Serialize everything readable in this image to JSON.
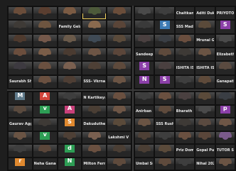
{
  "colors": {
    "accent": "#f4d35e",
    "tile_bg": "#262626",
    "letter_tiles": [
      "#3d7bb5",
      "#d4453b",
      "#2e9e55",
      "#e0892f",
      "#8b3fa8",
      "#c9407a",
      "#5f7a8a",
      "#7a5a3f"
    ]
  },
  "panels": [
    {
      "id": "top-left",
      "cols": 5,
      "rows": 6,
      "tiles": [
        {
          "name": "",
          "kind": "video",
          "c": "#6a4d3a"
        },
        {
          "name": "",
          "kind": "video",
          "c": "#5a3e30"
        },
        {
          "name": "",
          "kind": "video",
          "c": "#7b5b43"
        },
        {
          "name": "",
          "kind": "video",
          "c": "#4d5a3a",
          "active": true
        },
        {
          "name": "",
          "kind": "video",
          "c": "#6a4d3a"
        },
        {
          "name": "",
          "kind": "video",
          "c": "#3e3a36"
        },
        {
          "name": "",
          "kind": "video",
          "c": "#6e5540"
        },
        {
          "name": "Family Gelaz",
          "kind": "name"
        },
        {
          "name": "",
          "kind": "video",
          "c": "#8a6a4e"
        },
        {
          "name": "",
          "kind": "video",
          "c": "#5a4538"
        },
        {
          "name": "",
          "kind": "video",
          "c": "#4e3a2e"
        },
        {
          "name": "",
          "kind": "video",
          "c": "#74584a"
        },
        {
          "name": "",
          "kind": "video",
          "c": "#6a5a4a"
        },
        {
          "name": "",
          "kind": "video",
          "c": "#3f4a55"
        },
        {
          "name": "",
          "kind": "video",
          "c": "#5a4a3a"
        },
        {
          "name": "",
          "kind": "video",
          "c": "#6b4e3d"
        },
        {
          "name": "",
          "kind": "video",
          "c": "#7a5d48"
        },
        {
          "name": "",
          "kind": "video",
          "c": "#4a3b31"
        },
        {
          "name": "",
          "kind": "video",
          "c": "#6d5545"
        },
        {
          "name": "",
          "kind": "video",
          "c": "#5b463a"
        },
        {
          "name": "",
          "kind": "video",
          "c": "#3d3a40"
        },
        {
          "name": "",
          "kind": "video",
          "c": "#6a5040"
        },
        {
          "name": "",
          "kind": "video",
          "c": "#7a6050"
        },
        {
          "name": "",
          "kind": "video",
          "c": "#4e4036"
        },
        {
          "name": "",
          "kind": "video",
          "c": "#5e4a3c"
        },
        {
          "name": "Saurabh Shahane",
          "kind": "name"
        },
        {
          "name": "",
          "kind": "video",
          "c": "#6a5040"
        },
        {
          "name": "",
          "kind": "video",
          "c": "#4e3e34"
        },
        {
          "name": "SSS- Vkrnа 2020...",
          "kind": "name"
        },
        {
          "name": "",
          "kind": "video",
          "c": "#6b5444"
        }
      ]
    },
    {
      "id": "top-right",
      "cols": 5,
      "rows": 6,
      "tiles": [
        {
          "name": "",
          "kind": "video",
          "c": "#4a4a4a"
        },
        {
          "name": "",
          "kind": "video",
          "c": "#3e3e3e"
        },
        {
          "name": "Chaitkanya deni...",
          "kind": "name"
        },
        {
          "name": "Aditi Dukhale ...",
          "kind": "name"
        },
        {
          "name": "PRIYOTOSH D...",
          "kind": "name"
        },
        {
          "name": "",
          "kind": "video",
          "c": "#3a3a3a"
        },
        {
          "name": "",
          "kind": "letter",
          "l": "S",
          "li": 0
        },
        {
          "name": "SSS Madhuri Kh...",
          "kind": "name"
        },
        {
          "name": "",
          "kind": "video",
          "c": "#5a4a3a"
        },
        {
          "name": "",
          "kind": "letter",
          "l": "S",
          "li": 4
        },
        {
          "name": "",
          "kind": "video",
          "c": "#4a4040"
        },
        {
          "name": "",
          "kind": "video",
          "c": "#3a3e44"
        },
        {
          "name": "",
          "kind": "video",
          "c": "#6a4e3e"
        },
        {
          "name": "Mrunal Gandhi",
          "kind": "name"
        },
        {
          "name": "",
          "kind": "video",
          "c": "#4a4a4a"
        },
        {
          "name": "Sandeep Dua J...",
          "kind": "name"
        },
        {
          "name": "",
          "kind": "video",
          "c": "#5e4a3c"
        },
        {
          "name": "",
          "kind": "video",
          "c": "#3e3a36"
        },
        {
          "name": "",
          "kind": "video",
          "c": "#6a5444"
        },
        {
          "name": "Elizabeth Jekayi...",
          "kind": "name"
        },
        {
          "name": "",
          "kind": "letter",
          "l": "S",
          "li": 4
        },
        {
          "name": "",
          "kind": "video",
          "c": "#4a4040"
        },
        {
          "name": "ISHITA ISHITA",
          "kind": "name"
        },
        {
          "name": "ISHITA ISHITA",
          "kind": "name"
        },
        {
          "name": "",
          "kind": "video",
          "c": "#5a4a40"
        },
        {
          "name": "",
          "kind": "letter",
          "l": "N",
          "li": 4
        },
        {
          "name": "",
          "kind": "letter",
          "l": "S",
          "li": 4
        },
        {
          "name": "",
          "kind": "video",
          "c": "#3e3e3e"
        },
        {
          "name": "",
          "kind": "video",
          "c": "#5e4a3a"
        },
        {
          "name": "Ganapathy K 2...",
          "kind": "name"
        }
      ]
    },
    {
      "id": "bottom-left",
      "cols": 5,
      "rows": 6,
      "tiles": [
        {
          "name": "",
          "kind": "letter",
          "l": "M",
          "li": 6
        },
        {
          "name": "",
          "kind": "letter",
          "l": "A",
          "li": 1
        },
        {
          "name": "",
          "kind": "video",
          "c": "#3e3e3e"
        },
        {
          "name": "N Kartikeya G...",
          "kind": "name"
        },
        {
          "name": "",
          "kind": "video",
          "c": "#6a5040"
        },
        {
          "name": "",
          "kind": "video",
          "c": "#5a4a3e"
        },
        {
          "name": "",
          "kind": "letter",
          "l": "v",
          "li": 2
        },
        {
          "name": "",
          "kind": "letter",
          "l": "A",
          "li": 5
        },
        {
          "name": "",
          "kind": "video",
          "c": "#4a3e34"
        },
        {
          "name": "",
          "kind": "video",
          "c": "#6e5646"
        },
        {
          "name": "Gaurav Aggarw...",
          "kind": "name"
        },
        {
          "name": "",
          "kind": "video",
          "c": "#3e3a36"
        },
        {
          "name": "",
          "kind": "letter",
          "l": "S",
          "li": 3
        },
        {
          "name": "Dakuduthe Kut...",
          "kind": "name"
        },
        {
          "name": "",
          "kind": "video",
          "c": "#5a4a3a"
        },
        {
          "name": "",
          "kind": "video",
          "c": "#6a5444"
        },
        {
          "name": "",
          "kind": "letter",
          "l": "v",
          "li": 2
        },
        {
          "name": "",
          "kind": "video",
          "c": "#4e4036"
        },
        {
          "name": "",
          "kind": "video",
          "c": "#7a6050"
        },
        {
          "name": "Lakshmi V 2020...",
          "kind": "name"
        },
        {
          "name": "",
          "kind": "video",
          "c": "#3e3e3e"
        },
        {
          "name": "",
          "kind": "video",
          "c": "#5a463a"
        },
        {
          "name": "",
          "kind": "letter",
          "l": "d",
          "li": 2
        },
        {
          "name": "",
          "kind": "video",
          "c": "#6a5040"
        },
        {
          "name": "",
          "kind": "video",
          "c": "#4a3e34"
        },
        {
          "name": "",
          "kind": "letter",
          "l": "r",
          "li": 3
        },
        {
          "name": "Neha Ganagad...",
          "kind": "name"
        },
        {
          "name": "",
          "kind": "letter",
          "l": "N",
          "li": 2
        },
        {
          "name": "Milton Fernand...",
          "kind": "name"
        },
        {
          "name": "",
          "kind": "video",
          "c": "#5e4a3c"
        }
      ]
    },
    {
      "id": "bottom-right",
      "cols": 5,
      "rows": 6,
      "tiles": [
        {
          "name": "",
          "kind": "video",
          "c": "#3e3e3e"
        },
        {
          "name": "",
          "kind": "video",
          "c": "#6a5040"
        },
        {
          "name": "",
          "kind": "video",
          "c": "#4a4040"
        },
        {
          "name": "",
          "kind": "video",
          "c": "#5a4a3a"
        },
        {
          "name": "",
          "kind": "video",
          "c": "#3a3e44"
        },
        {
          "name": "Anirban Das 20...",
          "kind": "name"
        },
        {
          "name": "",
          "kind": "video",
          "c": "#5e4a3c"
        },
        {
          "name": "Bharath Krishna...",
          "kind": "name"
        },
        {
          "name": "",
          "kind": "video",
          "c": "#4a4a4a"
        },
        {
          "name": "",
          "kind": "letter",
          "l": "p",
          "li": 4
        },
        {
          "name": "",
          "kind": "video",
          "c": "#6a5444"
        },
        {
          "name": "SSS Rushika rai...",
          "kind": "name"
        },
        {
          "name": "",
          "kind": "video",
          "c": "#3e3a36"
        },
        {
          "name": "",
          "kind": "video",
          "c": "#5a4a40"
        },
        {
          "name": "",
          "kind": "video",
          "c": "#6e5646"
        },
        {
          "name": "",
          "kind": "video",
          "c": "#4e4036"
        },
        {
          "name": "",
          "kind": "video",
          "c": "#3e3e3e"
        },
        {
          "name": "",
          "kind": "video",
          "c": "#6a5040"
        },
        {
          "name": "",
          "kind": "video",
          "c": "#5a463a"
        },
        {
          "name": "",
          "kind": "video",
          "c": "#7a5a8a"
        },
        {
          "name": "",
          "kind": "video",
          "c": "#4a3e34"
        },
        {
          "name": "",
          "kind": "video",
          "c": "#5a4a3a"
        },
        {
          "name": "Priz Domini P J...",
          "kind": "name"
        },
        {
          "name": "Gopal Punmetih...",
          "kind": "name"
        },
        {
          "name": "TUTOR Sinha...",
          "kind": "name"
        },
        {
          "name": "Umbai Surya",
          "kind": "name"
        },
        {
          "name": "",
          "kind": "video",
          "c": "#5e4a3c"
        },
        {
          "name": "",
          "kind": "video",
          "c": "#3e3e3e"
        },
        {
          "name": "Nihal 2020 TVM...",
          "kind": "name"
        },
        {
          "name": "",
          "kind": "video",
          "c": "#6a5444"
        }
      ]
    }
  ]
}
